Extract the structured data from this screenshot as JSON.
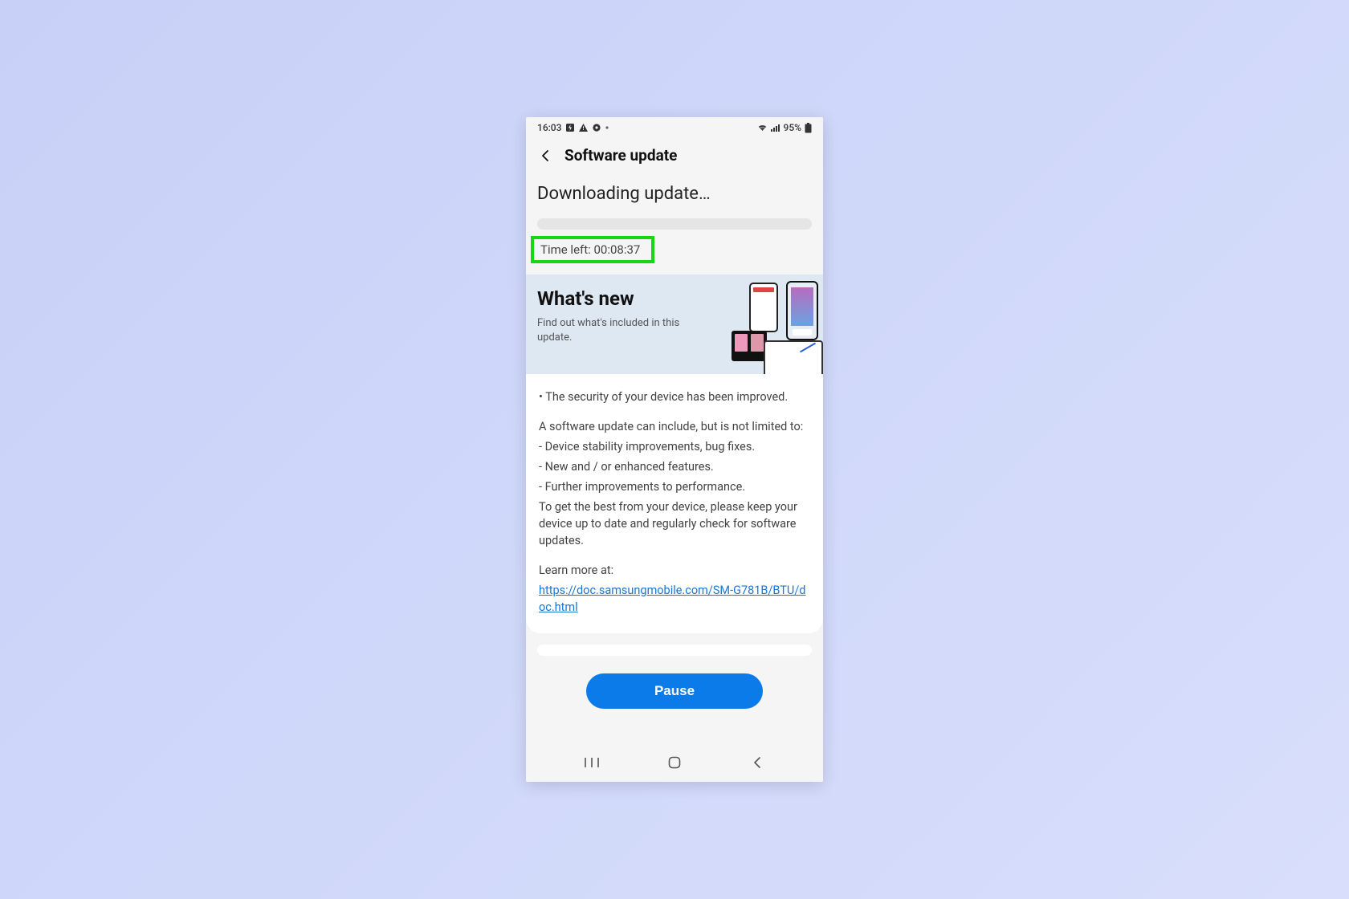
{
  "statusbar": {
    "time": "16:03",
    "battery_text": "95%"
  },
  "appbar": {
    "title": "Software update"
  },
  "download": {
    "heading": "Downloading update…",
    "time_left_label": "Time left: 00:08:37"
  },
  "whatsnew": {
    "title": "What's new",
    "subtitle": "Find out what's included in this update."
  },
  "details": {
    "bullet1": "• The security of your device has been improved.",
    "intro": "A software update can include, but is not limited to:",
    "item1": " - Device stability improvements, bug fixes.",
    "item2": " - New and / or enhanced features.",
    "item3": " - Further improvements to performance.",
    "outro": "To get the best from your device, please keep your device up to date and regularly check for software updates.",
    "learn_label": "Learn more at:",
    "learn_url": "https://doc.samsungmobile.com/SM-G781B/BTU/doc.html"
  },
  "actions": {
    "pause_label": "Pause"
  }
}
